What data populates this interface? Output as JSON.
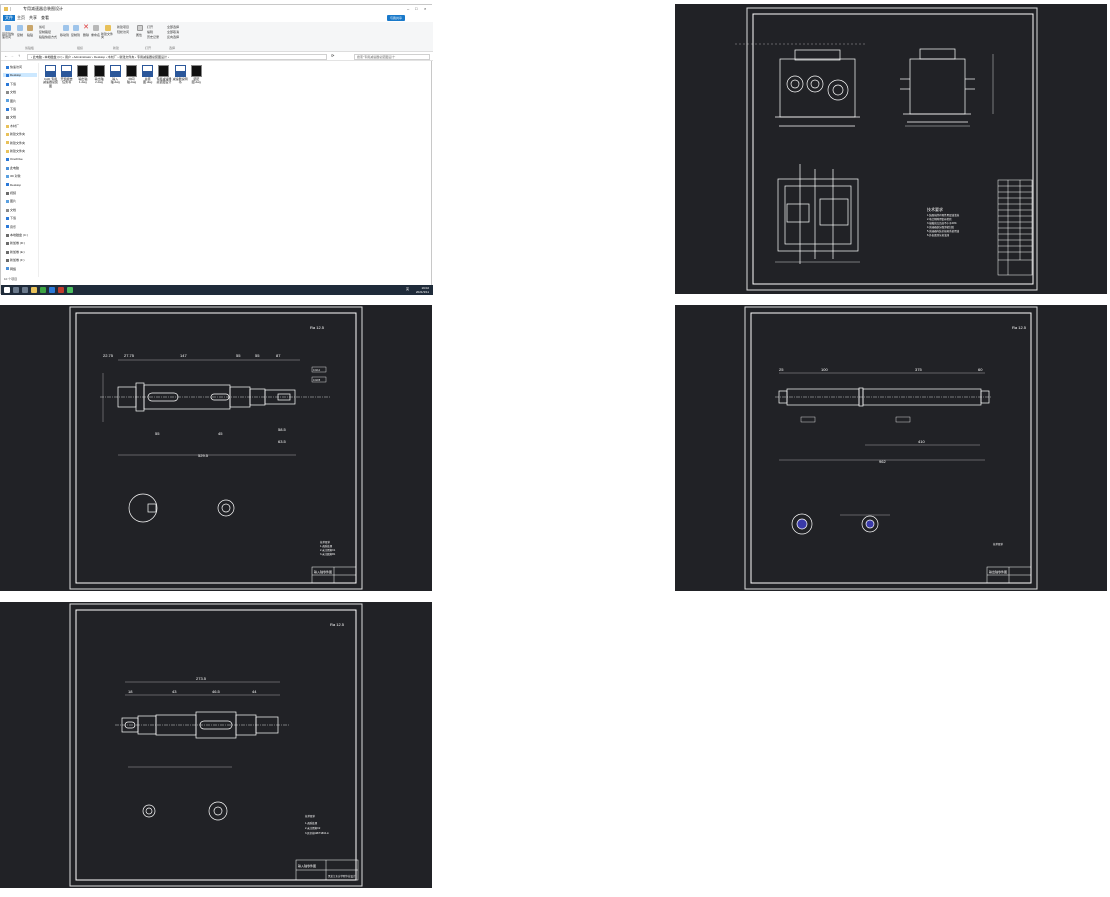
{
  "explorer": {
    "title": "专用减速器总装图设计",
    "share_label": "与我共享",
    "menu_tabs": [
      "文件",
      "主页",
      "共享",
      "查看"
    ],
    "ribbon": {
      "pin_label": "固定到快速访问",
      "copy_label": "复制",
      "paste_label": "粘贴",
      "cut_label": "剪切",
      "copy_path_label": "复制路径",
      "paste_shortcut_label": "粘贴快捷方式",
      "move_to_label": "移动到",
      "copy_to_label": "复制到",
      "delete_label": "删除",
      "rename_label": "重命名",
      "new_folder_label": "新建文件夹",
      "new_item_label": "新建项目",
      "easy_access_label": "轻松访问",
      "properties_label": "属性",
      "open_label": "打开",
      "edit_label": "编辑",
      "history_label": "历史记录",
      "select_all_label": "全部选择",
      "select_none_label": "全部取消",
      "invert_label": "反向选择",
      "groups": [
        "剪贴板",
        "组织",
        "新建",
        "打开",
        "选择"
      ]
    },
    "breadcrumb": "› 此电脑 › 本地磁盘 (C:) › 用户 › Administrator › Desktop › 木材厂 › 新建文件夹 › 专用减速器总装图设计 ›",
    "search_placeholder": "搜索\"专用减速器总装图设计\"",
    "nav_items": [
      {
        "label": "快速访问",
        "icon": "star-icon",
        "color": "#2b79d8"
      },
      {
        "label": "Desktop",
        "icon": "desktop-icon",
        "color": "#2b79d8",
        "selected": true
      },
      {
        "label": "下载",
        "icon": "download-icon",
        "color": "#2b79d8"
      },
      {
        "label": "文档",
        "icon": "document-icon",
        "color": "#8a8a8a"
      },
      {
        "label": "图片",
        "icon": "picture-icon",
        "color": "#5aa0e0"
      },
      {
        "label": "下载",
        "icon": "download-icon",
        "color": "#2b79d8"
      },
      {
        "label": "文档",
        "icon": "document-icon",
        "color": "#8a8a8a"
      },
      {
        "label": "木材厂",
        "icon": "folder-icon",
        "color": "#e8c15a"
      },
      {
        "label": "新建文件夹",
        "icon": "folder-icon",
        "color": "#e8c15a"
      },
      {
        "label": "新建文件夹",
        "icon": "folder-icon",
        "color": "#e8c15a"
      },
      {
        "label": "新建文件夹",
        "icon": "folder-icon",
        "color": "#e8c15a"
      },
      {
        "label": "OneDrive",
        "icon": "cloud-icon",
        "color": "#2b79d8"
      },
      {
        "label": "此电脑",
        "icon": "pc-icon",
        "color": "#4a90d9"
      },
      {
        "label": "3D 对象",
        "icon": "cube-icon",
        "color": "#5aa0e0"
      },
      {
        "label": "Desktop",
        "icon": "desktop-icon",
        "color": "#2b79d8"
      },
      {
        "label": "视频",
        "icon": "video-icon",
        "color": "#6b6b6b"
      },
      {
        "label": "图片",
        "icon": "picture-icon",
        "color": "#5aa0e0"
      },
      {
        "label": "文档",
        "icon": "document-icon",
        "color": "#8a8a8a"
      },
      {
        "label": "下载",
        "icon": "download-icon",
        "color": "#2b79d8"
      },
      {
        "label": "音乐",
        "icon": "music-icon",
        "color": "#2b79d8"
      },
      {
        "label": "本地磁盘 (C:)",
        "icon": "drive-icon",
        "color": "#6b6b6b"
      },
      {
        "label": "新加卷 (D:)",
        "icon": "drive-icon",
        "color": "#6b6b6b"
      },
      {
        "label": "新加卷 (E:)",
        "icon": "drive-icon",
        "color": "#6b6b6b"
      },
      {
        "label": "新加卷 (F:)",
        "icon": "drive-icon",
        "color": "#6b6b6b"
      },
      {
        "label": "网络",
        "icon": "network-icon",
        "color": "#4a90d9"
      }
    ],
    "files": [
      {
        "label": "CAD 专用减速器总装图",
        "type": "doc"
      },
      {
        "label": "开题报告 任务书",
        "type": "doc"
      },
      {
        "label": "输出轴1.dwg",
        "type": "dwg"
      },
      {
        "label": "输出轴2.dwg",
        "type": "dwg"
      },
      {
        "label": "输入轴.dwg",
        "type": "doc"
      },
      {
        "label": "中间轴.dwg",
        "type": "dwg"
      },
      {
        "label": "总装图.dwg",
        "type": "doc"
      },
      {
        "label": "专用减速器总装图设计",
        "type": "dwg"
      },
      {
        "label": "减速器说明书",
        "type": "doc"
      },
      {
        "label": "装配图.dwg",
        "type": "dwg"
      }
    ],
    "status": "10 个项目",
    "tray_time": "19:02",
    "tray_date": "2021/3/11",
    "tray_lang": "英"
  },
  "drawings": {
    "assembly": {
      "notes_title": "技术要求",
      "notes": [
        "1.装配前所有零件用煤油清洗",
        "2.啮合侧隙用铅丝检验",
        "3.接触斑点齿高不小于40%",
        "4.减速器剖分面涂密封胶",
        "5.减速器内装全损耗系统用油",
        "6.外表面涂灰色油漆"
      ]
    },
    "input_shaft": {
      "roughness": "Ra 12.5",
      "dims_top": [
        "22.75",
        "27.75",
        "147",
        "55",
        "55",
        "87"
      ],
      "dims_bottom": [
        "55",
        "45",
        "58.5",
        "63.5"
      ],
      "overall": "529.5",
      "tol1": "0.02 A",
      "tol2": "0.02 B",
      "notes_title": "技术要求",
      "notes": [
        "1.调质处理",
        "2.未注倒角C1",
        "3.未注圆角R1"
      ],
      "title_block": "输入轴零件图"
    },
    "output_shaft_1": {
      "roughness": "Ra 12.5",
      "dims_top": [
        "25",
        "100",
        "375",
        "60"
      ],
      "overall": "962",
      "mid": "410",
      "notes_title": "技术要求",
      "title_block": "输出轴零件图"
    },
    "middle_shaft": {
      "roughness": "Ra 12.5",
      "dims_top": [
        "273.5",
        "18",
        "43",
        "46.5",
        "44"
      ],
      "notes_title": "技术要求",
      "notes": [
        "1.调质处理",
        "2.未注倒角C2",
        "3.其余按GB/T1804-m"
      ],
      "title_block": "输入轴零件图",
      "school": "黑龙江东方学院毕业设计"
    }
  }
}
